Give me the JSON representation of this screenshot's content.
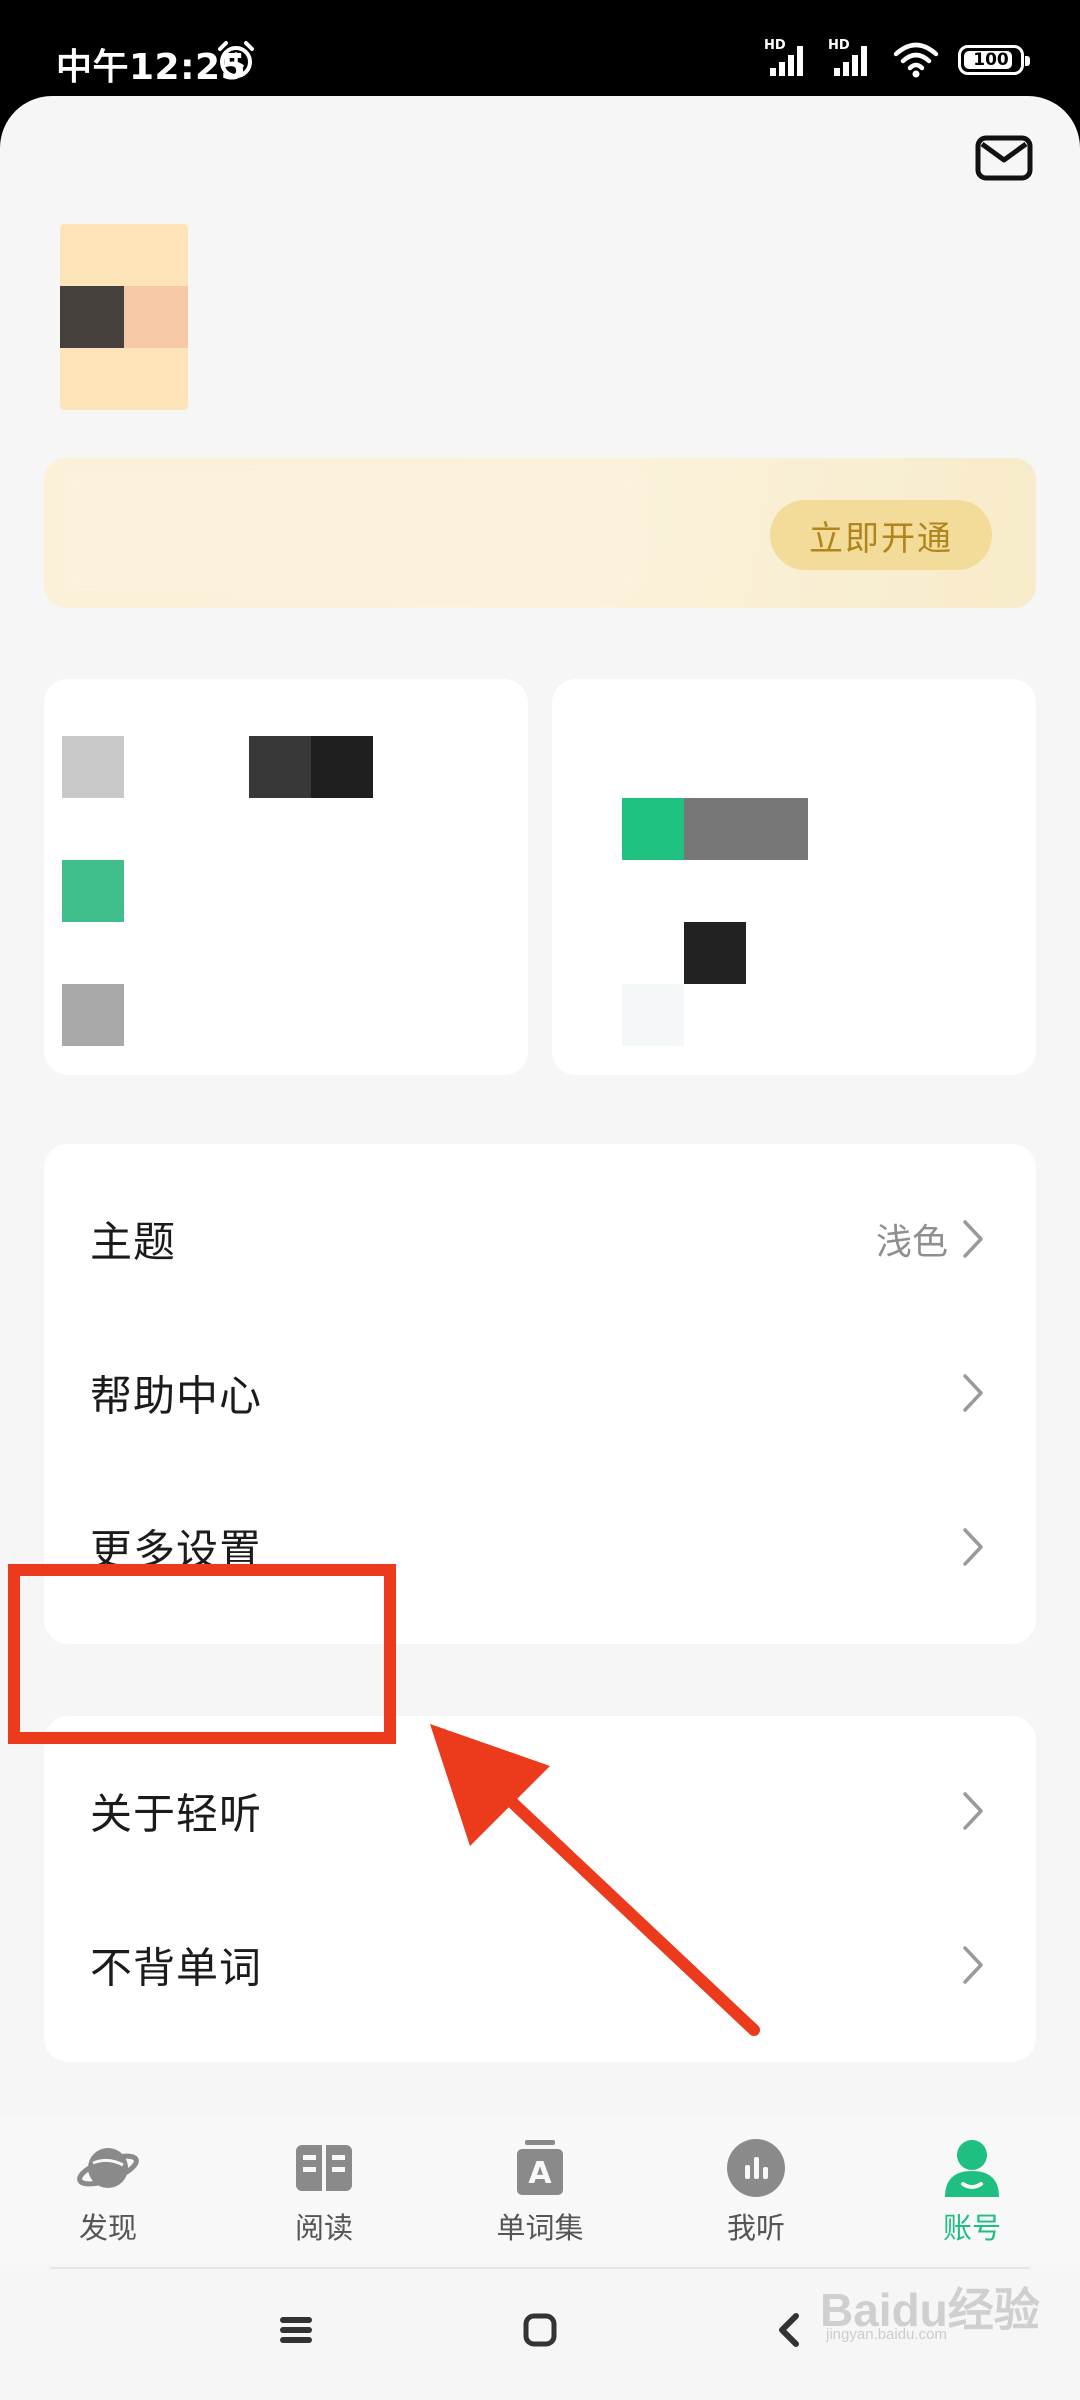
{
  "status_bar": {
    "time": "中午12:25",
    "network_badge_1": "HD",
    "network_badge_2": "HD",
    "battery": "100"
  },
  "vip_banner": {
    "button_label": "立即开通"
  },
  "settings_group_1": [
    {
      "label": "主题",
      "value": "浅色"
    },
    {
      "label": "帮助中心",
      "value": ""
    },
    {
      "label": "更多设置",
      "value": ""
    }
  ],
  "settings_group_2": [
    {
      "label": "关于轻听"
    },
    {
      "label": "不背单词"
    }
  ],
  "bottom_nav": [
    {
      "label": "发现",
      "icon": "planet-icon",
      "active": false
    },
    {
      "label": "阅读",
      "icon": "book-icon",
      "active": false
    },
    {
      "label": "单词集",
      "icon": "word-book-icon",
      "active": false
    },
    {
      "label": "我听",
      "icon": "listen-icon",
      "active": false
    },
    {
      "label": "账号",
      "icon": "account-icon",
      "active": true
    }
  ],
  "colors": {
    "accent": "#1fbf82",
    "vip_button_bg": "#f3dc99",
    "vip_button_text": "#b0851d",
    "annotation": "#ec3a1d"
  },
  "watermark": {
    "brand": "Baidu经验",
    "sub": "jingyan.baidu.com"
  }
}
